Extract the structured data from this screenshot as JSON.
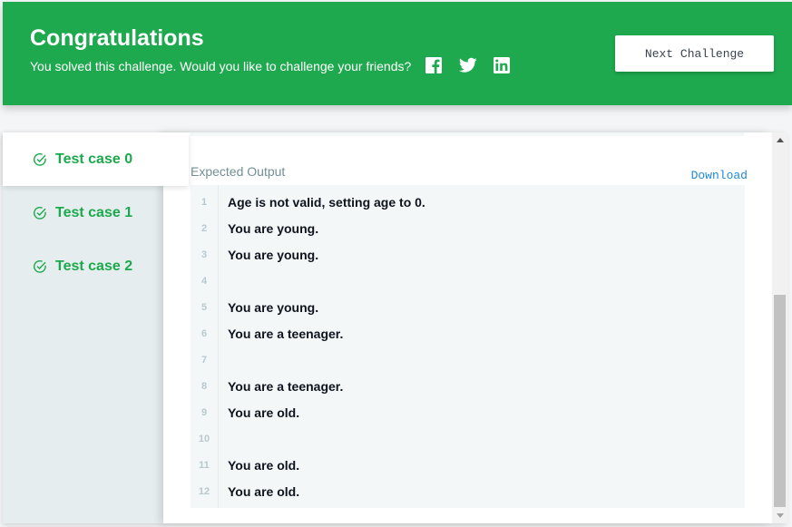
{
  "banner": {
    "title": "Congratulations",
    "subtitle": "You solved this challenge. Would you like to challenge your friends?",
    "social": [
      "facebook-icon",
      "twitter-icon",
      "linkedin-icon"
    ],
    "next_button": "Next Challenge",
    "color": "#1ea94e"
  },
  "sidebar": {
    "test_cases": [
      {
        "label": "Test case 0",
        "status": "passed",
        "active": true
      },
      {
        "label": "Test case 1",
        "status": "passed",
        "active": false
      },
      {
        "label": "Test case 2",
        "status": "passed",
        "active": false
      }
    ]
  },
  "output": {
    "label": "Expected Output",
    "download": "Download",
    "lines": [
      {
        "n": "1",
        "text": "Age is not valid, setting age to 0."
      },
      {
        "n": "2",
        "text": "You are young."
      },
      {
        "n": "3",
        "text": "You are young."
      },
      {
        "n": "4",
        "text": ""
      },
      {
        "n": "5",
        "text": "You are young."
      },
      {
        "n": "6",
        "text": "You are a teenager."
      },
      {
        "n": "7",
        "text": ""
      },
      {
        "n": "8",
        "text": "You are a teenager."
      },
      {
        "n": "9",
        "text": "You are old."
      },
      {
        "n": "10",
        "text": ""
      },
      {
        "n": "11",
        "text": "You are old."
      },
      {
        "n": "12",
        "text": "You are old."
      }
    ]
  }
}
